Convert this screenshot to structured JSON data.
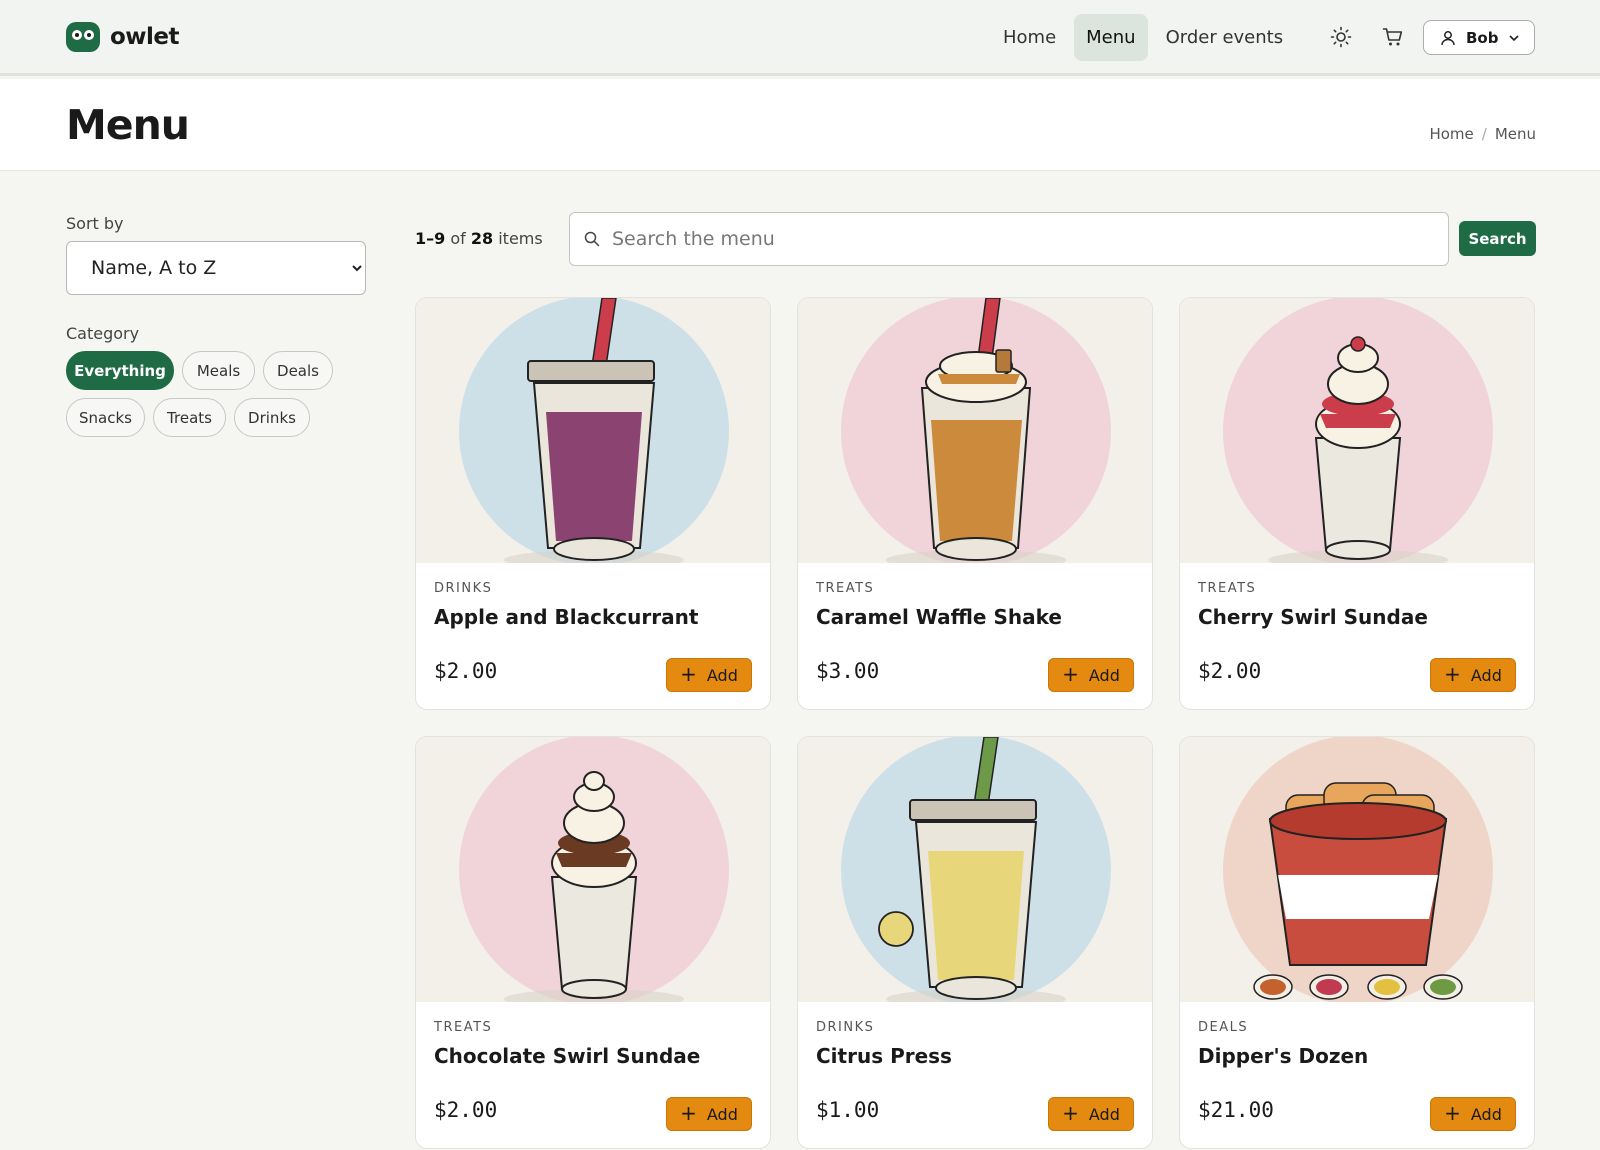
{
  "header": {
    "brand": "owlet",
    "nav": [
      {
        "label": "Home",
        "active": false
      },
      {
        "label": "Menu",
        "active": true
      },
      {
        "label": "Order events",
        "active": false
      }
    ],
    "user_name": "Bob",
    "icons": [
      "sun-icon",
      "cart-icon",
      "user-icon",
      "chevron-down-icon"
    ]
  },
  "page": {
    "title": "Menu",
    "breadcrumb": [
      "Home",
      "Menu"
    ]
  },
  "sidebar": {
    "sort_label": "Sort by",
    "sort_value": "Name, A to Z",
    "category_label": "Category",
    "categories": [
      {
        "label": "Everything",
        "active": true
      },
      {
        "label": "Meals",
        "active": false
      },
      {
        "label": "Deals",
        "active": false
      },
      {
        "label": "Snacks",
        "active": false
      },
      {
        "label": "Treats",
        "active": false
      },
      {
        "label": "Drinks",
        "active": false
      }
    ]
  },
  "results": {
    "range": "1–9",
    "of": "of",
    "total": "28",
    "unit": "items",
    "search_placeholder": "Search the menu",
    "search_button": "Search"
  },
  "items": [
    {
      "category": "DRINKS",
      "name": "Apple and Blackcurrant",
      "price": "$2.00",
      "add_label": "Add",
      "art": "cup",
      "bg": "#cde0e8",
      "fill": "#8b4472",
      "straw": "#cc3d4b"
    },
    {
      "category": "TREATS",
      "name": "Caramel Waffle Shake",
      "price": "$3.00",
      "add_label": "Add",
      "art": "shake",
      "bg": "#f0d4da",
      "fill": "#cc8a3c",
      "straw": "#cc3d4b"
    },
    {
      "category": "TREATS",
      "name": "Cherry Swirl Sundae",
      "price": "$2.00",
      "add_label": "Add",
      "art": "sundae",
      "bg": "#f0d4da",
      "fill": "#cc3d4b",
      "straw": "#cc3d4b"
    },
    {
      "category": "TREATS",
      "name": "Chocolate Swirl Sundae",
      "price": "$2.00",
      "add_label": "Add",
      "art": "sundae",
      "bg": "#f0d4da",
      "fill": "#6b3a22",
      "straw": ""
    },
    {
      "category": "DRINKS",
      "name": "Citrus Press",
      "price": "$1.00",
      "add_label": "Add",
      "art": "cup",
      "bg": "#cde0e8",
      "fill": "#e8d77a",
      "straw": "#6c9a48"
    },
    {
      "category": "DEALS",
      "name": "Dipper's Dozen",
      "price": "$21.00",
      "add_label": "Add",
      "art": "bucket",
      "bg": "#efd5c8",
      "fill": "#c84d3e",
      "straw": ""
    }
  ]
}
